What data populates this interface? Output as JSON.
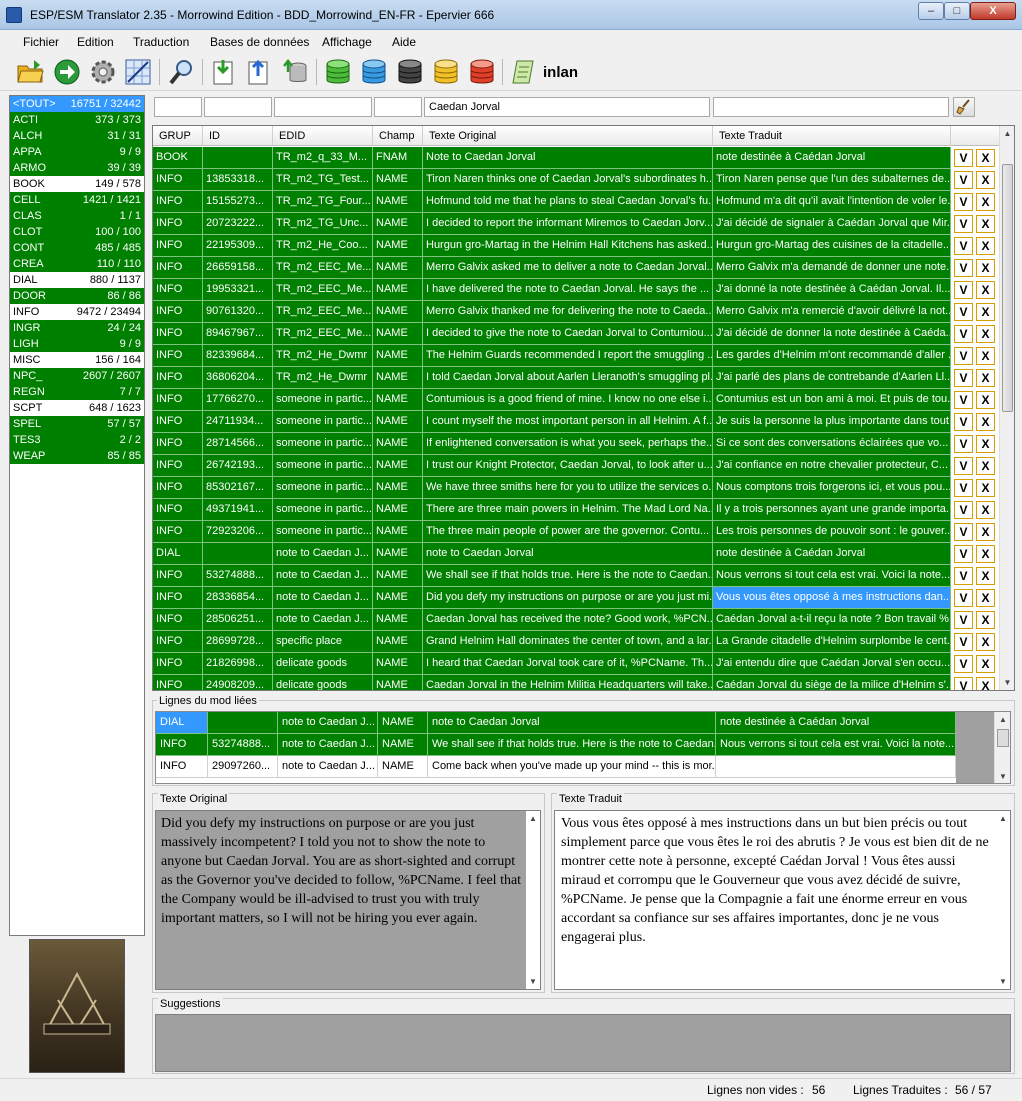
{
  "window": {
    "title": "ESP/ESM Translator 2.35 - Morrowind Edition - BDD_Morrowind_EN-FR - Epervier 666",
    "minimize": "–",
    "maximize": "□",
    "close": "X"
  },
  "menu": [
    "Fichier",
    "Edition",
    "Traduction",
    "Bases de données",
    "Affichage",
    "Aide"
  ],
  "toolbar": {
    "label": "inlan"
  },
  "categories": [
    {
      "name": "<TOUT>",
      "count": "16751 / 32442",
      "state": "selected"
    },
    {
      "name": "ACTI",
      "count": "373 / 373",
      "state": "done"
    },
    {
      "name": "ALCH",
      "count": "31 / 31",
      "state": "done"
    },
    {
      "name": "APPA",
      "count": "9 / 9",
      "state": "done"
    },
    {
      "name": "ARMO",
      "count": "39 / 39",
      "state": "done"
    },
    {
      "name": "BOOK",
      "count": "149 / 578",
      "state": "partial"
    },
    {
      "name": "CELL",
      "count": "1421 / 1421",
      "state": "done"
    },
    {
      "name": "CLAS",
      "count": "1 / 1",
      "state": "done"
    },
    {
      "name": "CLOT",
      "count": "100 / 100",
      "state": "done"
    },
    {
      "name": "CONT",
      "count": "485 / 485",
      "state": "done"
    },
    {
      "name": "CREA",
      "count": "110 / 110",
      "state": "done"
    },
    {
      "name": "DIAL",
      "count": "880 / 1137",
      "state": "partial"
    },
    {
      "name": "DOOR",
      "count": "86 / 86",
      "state": "done"
    },
    {
      "name": "INFO",
      "count": "9472 / 23494",
      "state": "partial"
    },
    {
      "name": "INGR",
      "count": "24 / 24",
      "state": "done"
    },
    {
      "name": "LIGH",
      "count": "9 / 9",
      "state": "done"
    },
    {
      "name": "MISC",
      "count": "156 / 164",
      "state": "partial"
    },
    {
      "name": "NPC_",
      "count": "2607 / 2607",
      "state": "done"
    },
    {
      "name": "REGN",
      "count": "7 / 7",
      "state": "done"
    },
    {
      "name": "SCPT",
      "count": "648 / 1623",
      "state": "partial"
    },
    {
      "name": "SPEL",
      "count": "57 / 57",
      "state": "done"
    },
    {
      "name": "TES3",
      "count": "2 / 2",
      "state": "done"
    },
    {
      "name": "WEAP",
      "count": "85 / 85",
      "state": "done"
    }
  ],
  "filters": {
    "grup": "",
    "id": "",
    "edid": "",
    "champ": "",
    "texte_original": "Caedan Jorval",
    "texte_traduit": ""
  },
  "grid": {
    "headers": [
      "GRUP",
      "ID",
      "EDID",
      "Champ",
      "Texte Original",
      "Texte Traduit"
    ],
    "validate_label": "V",
    "reject_label": "X",
    "rows": [
      [
        "BOOK",
        "",
        "TR_m2_q_33_M...",
        "FNAM",
        "Note to Caedan Jorval",
        "note destinée à Caédan Jorval"
      ],
      [
        "INFO",
        "13853318...",
        "TR_m2_TG_Test...",
        "NAME",
        "Tiron Naren thinks one of Caedan Jorval's subordinates h...",
        "Tiron Naren pense que l'un des subalternes de..."
      ],
      [
        "INFO",
        "15155273...",
        "TR_m2_TG_Four...",
        "NAME",
        "Hofmund told me that he plans to steal Caedan Jorval's fu...",
        "Hofmund m'a dit qu'il avait l'intention de voler le..."
      ],
      [
        "INFO",
        "20723222...",
        "TR_m2_TG_Unc...",
        "NAME",
        "I decided to report the informant Miremos to Caedan Jorv...",
        "J'ai décidé de signaler à Caédan Jorval que Mir..."
      ],
      [
        "INFO",
        "22195309...",
        "TR_m2_He_Coo...",
        "NAME",
        "Hurgun gro-Martag in the Helnim Hall Kitchens has asked...",
        "Hurgun gro-Martag des cuisines de la citadelle..."
      ],
      [
        "INFO",
        "26659158...",
        "TR_m2_EEC_Me...",
        "NAME",
        "Merro Galvix asked me to deliver a note to Caedan Jorval...",
        "Merro Galvix m'a demandé de donner une note..."
      ],
      [
        "INFO",
        "19953321...",
        "TR_m2_EEC_Me...",
        "NAME",
        "I have delivered the note to Caedan Jorval. He says the ...",
        "J'ai donné la note destinée à Caédan Jorval. Il..."
      ],
      [
        "INFO",
        "90761320...",
        "TR_m2_EEC_Me...",
        "NAME",
        "Merro Galvix thanked me for delivering the note to Caeda...",
        "Merro Galvix m'a remercié d'avoir délivré la not..."
      ],
      [
        "INFO",
        "89467967...",
        "TR_m2_EEC_Me...",
        "NAME",
        "I decided to give the note to Caedan Jorval to Contumiou...",
        "J'ai décidé de donner la note destinée à Caéda..."
      ],
      [
        "INFO",
        "82339684...",
        "TR_m2_He_Dwmr",
        "NAME",
        "The Helnim Guards recommended I report the smuggling ...",
        "Les gardes d'Helnim m'ont recommandé d'aller ..."
      ],
      [
        "INFO",
        "36806204...",
        "TR_m2_He_Dwmr",
        "NAME",
        "I told Caedan Jorval about Aarlen Lleranoth's smuggling pl...",
        "J'ai parlé des plans de contrebande d'Aarlen Ll..."
      ],
      [
        "INFO",
        "17766270...",
        "someone in partic...",
        "NAME",
        "Contumious is a good friend of mine. I know no one else i...",
        "Contumius est un bon ami à moi. Et puis de tou..."
      ],
      [
        "INFO",
        "24711934...",
        "someone in partic...",
        "NAME",
        "I count myself the most important person in all Helnim. A f...",
        "Je suis la personne la plus importante dans tout..."
      ],
      [
        "INFO",
        "28714566...",
        "someone in partic...",
        "NAME",
        "If enlightened conversation is what you seek, perhaps the...",
        "Si ce sont des conversations éclairées que vo..."
      ],
      [
        "INFO",
        "26742193...",
        "someone in partic...",
        "NAME",
        "I trust our Knight Protector, Caedan Jorval, to look after u...",
        "J'ai confiance en notre chevalier protecteur, C..."
      ],
      [
        "INFO",
        "85302167...",
        "someone in partic...",
        "NAME",
        "We have three smiths here for you to utilize the services o...",
        "Nous comptons trois forgerons ici, et vous pou..."
      ],
      [
        "INFO",
        "49371941...",
        "someone in partic...",
        "NAME",
        "There are three main powers in Helnim. The Mad Lord Na...",
        "Il y a trois personnes ayant une grande importa..."
      ],
      [
        "INFO",
        "72923206...",
        "someone in partic...",
        "NAME",
        "The three main people of power are the governor. Contu...",
        "Les trois personnes de pouvoir sont : le gouver..."
      ],
      [
        "DIAL",
        "",
        "note to Caedan J...",
        "NAME",
        "note to Caedan Jorval",
        "note destinée à Caédan Jorval"
      ],
      [
        "INFO",
        "53274888...",
        "note to Caedan J...",
        "NAME",
        "We shall see if that holds true. Here is the note to Caedan...",
        "Nous verrons si tout cela est vrai. Voici la note..."
      ],
      [
        "INFO",
        "28336854...",
        "note to Caedan J...",
        "NAME",
        "Did you defy my instructions on purpose or are you just mi...",
        "Vous vous êtes opposé à mes instructions dan..."
      ],
      [
        "INFO",
        "28506251...",
        "note to Caedan J...",
        "NAME",
        "Caedan Jorval has received the note? Good work, %PCN...",
        "Caédan Jorval a-t-il reçu la note ? Bon travail %..."
      ],
      [
        "INFO",
        "28699728...",
        "specific place",
        "NAME",
        "Grand Helnim Hall dominates the center of town, and a lar...",
        "La Grande citadelle d'Helnim surplombe le cent..."
      ],
      [
        "INFO",
        "21826998...",
        "delicate goods",
        "NAME",
        "I heard that Caedan Jorval took care of it, %PCName. Th...",
        "J'ai entendu dire que Caédan Jorval s'en occu..."
      ],
      [
        "INFO",
        "24908209...",
        "delicate goods",
        "NAME",
        "Caedan Jorval in the Helnim Militia Headquarters will take...",
        "Caédan Jorval du siège de la milice d'Helnim s'..."
      ]
    ]
  },
  "linked": {
    "label": "Lignes du mod liées",
    "rows": [
      [
        "DIAL",
        "",
        "note to Caedan J...",
        "NAME",
        "note to Caedan Jorval",
        "note destinée à Caédan Jorval"
      ],
      [
        "INFO",
        "53274888...",
        "note to Caedan J...",
        "NAME",
        "We shall see if that holds true. Here is the note to Caedan...",
        "Nous verrons si tout cela est vrai. Voici la note..."
      ],
      [
        "INFO",
        "29097260...",
        "note to Caedan J...",
        "NAME",
        "Come back when you've made up your mind -- this is mor...",
        ""
      ]
    ]
  },
  "original": {
    "label": "Texte Original",
    "text": "Did you defy my instructions on purpose or are you just massively incompetent? I told you not to show the note to anyone but Caedan Jorval. You are as short-sighted and corrupt as the Governor you've decided to follow, %PCName. I feel that the Company would be ill-advised to trust you with truly important matters, so I will not be hiring you ever again."
  },
  "translated": {
    "label": "Texte Traduit",
    "text": "Vous vous êtes opposé à mes instructions dans un but bien précis ou tout simplement parce que vous êtes le roi des abrutis ? Je vous est bien dit de ne montrer cette note à personne, excepté Caédan Jorval ! Vous êtes aussi miraud et corrompu que le Gouverneur que vous avez décidé de suivre, %PCName. Je pense que la Compagnie a fait une énorme erreur en vous accordant sa confiance sur ses affaires importantes, donc je ne vous engagerai plus."
  },
  "suggestions": {
    "label": "Suggestions"
  },
  "status": {
    "non_empty_label": "Lignes non vides :",
    "non_empty_value": "56",
    "translated_label": "Lignes Traduites :",
    "translated_value": "56 / 57"
  },
  "colors": {
    "done": "#008000",
    "selected": "#3399ff",
    "partial": "#ffffff"
  },
  "icons": [
    "open-folder-icon",
    "go-arrow-icon",
    "settings-gear-icon",
    "grid-icon",
    "search-magnifier-icon",
    "import-icon",
    "export-icon",
    "database-transfer-icon",
    "db-green-icon",
    "db-blue-icon",
    "db-black-icon",
    "db-yellow-icon",
    "db-red-icon",
    "scroll-icon",
    "broom-icon"
  ]
}
